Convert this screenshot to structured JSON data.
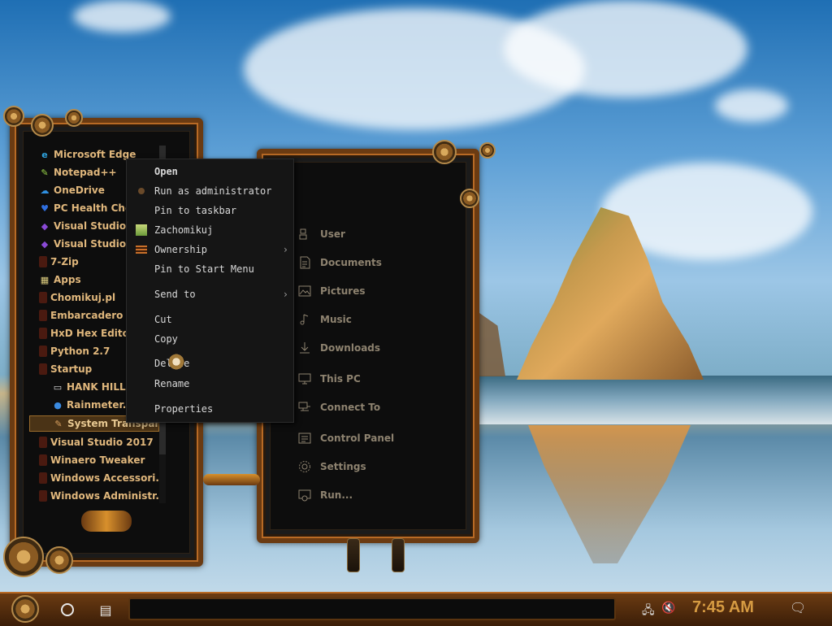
{
  "start_menu": {
    "apps": [
      {
        "label": "Microsoft Edge",
        "icon": "edge-icon",
        "color": "#2fa4e0"
      },
      {
        "label": "Notepad++",
        "icon": "notepad-icon",
        "color": "#9ad64a"
      },
      {
        "label": "OneDrive",
        "icon": "cloud-icon",
        "color": "#2f8fe0"
      },
      {
        "label": "PC Health Chec",
        "icon": "health-icon",
        "color": "#2f6fe0"
      },
      {
        "label": "Visual Studio 2",
        "icon": "vs-icon",
        "color": "#8a4ad6"
      },
      {
        "label": "Visual Studio In",
        "icon": "vs-icon",
        "color": "#8a4ad6"
      },
      {
        "label": "7-Zip",
        "icon": "folder-icon",
        "color": "#4a1a10"
      },
      {
        "label": "Apps",
        "icon": "apps-icon",
        "color": "#e0d080"
      },
      {
        "label": "Chomikuj.pl",
        "icon": "folder-icon",
        "color": "#4a1a10"
      },
      {
        "label": "Embarcadero D",
        "icon": "folder-icon",
        "color": "#4a1a10"
      },
      {
        "label": "HxD Hex Editor",
        "icon": "folder-icon",
        "color": "#4a1a10"
      },
      {
        "label": "Python 2.7",
        "icon": "folder-icon",
        "color": "#4a1a10"
      },
      {
        "label": "Startup",
        "icon": "folder-icon",
        "color": "#4a1a10"
      },
      {
        "label": "HANK HILLL",
        "icon": "monitor-icon",
        "color": "#dddddd",
        "sub": true
      },
      {
        "label": "Rainmeter.e",
        "icon": "drop-icon",
        "color": "#3a8ae0",
        "sub": true
      },
      {
        "label": "System Transpar...",
        "icon": "wrench-icon",
        "color": "#d8a060",
        "sub": true,
        "selected": true
      },
      {
        "label": "Visual Studio 2017",
        "icon": "folder-icon",
        "color": "#4a1a10"
      },
      {
        "label": "Winaero Tweaker",
        "icon": "folder-icon",
        "color": "#4a1a10"
      },
      {
        "label": "Windows Accessori...",
        "icon": "folder-icon",
        "color": "#4a1a10"
      },
      {
        "label": "Windows Administr...",
        "icon": "folder-icon",
        "color": "#4a1a10"
      }
    ]
  },
  "context_menu": {
    "items": [
      {
        "label": "Open",
        "bold": true
      },
      {
        "label": "Run as administrator",
        "icon": "shield-icon"
      },
      {
        "label": "Pin to taskbar"
      },
      {
        "label": "Zachomikuj",
        "icon": "chomikuj-icon"
      },
      {
        "label": "Ownership",
        "icon": "ownership-icon",
        "submenu": true
      },
      {
        "label": "Pin to Start Menu"
      },
      {
        "label": "Send to",
        "submenu": true
      },
      {
        "label": "Cut"
      },
      {
        "label": "Copy"
      },
      {
        "label": "Delete"
      },
      {
        "label": "Rename"
      },
      {
        "label": "Properties"
      }
    ],
    "submenu_arrow": "›"
  },
  "places": [
    {
      "label": "User",
      "icon": "user-icon"
    },
    {
      "label": "Documents",
      "icon": "documents-icon"
    },
    {
      "label": "Pictures",
      "icon": "pictures-icon"
    },
    {
      "label": "Music",
      "icon": "music-icon"
    },
    {
      "label": "Downloads",
      "icon": "downloads-icon"
    },
    {
      "label": "This PC",
      "icon": "computer-icon"
    },
    {
      "label": "Connect To",
      "icon": "connect-icon"
    },
    {
      "label": "Control Panel",
      "icon": "control-panel-icon"
    },
    {
      "label": "Settings",
      "icon": "settings-icon"
    },
    {
      "label": "Run...",
      "icon": "run-icon"
    }
  ],
  "taskbar": {
    "clock": "7:45 AM",
    "accent": "#d69b42"
  }
}
